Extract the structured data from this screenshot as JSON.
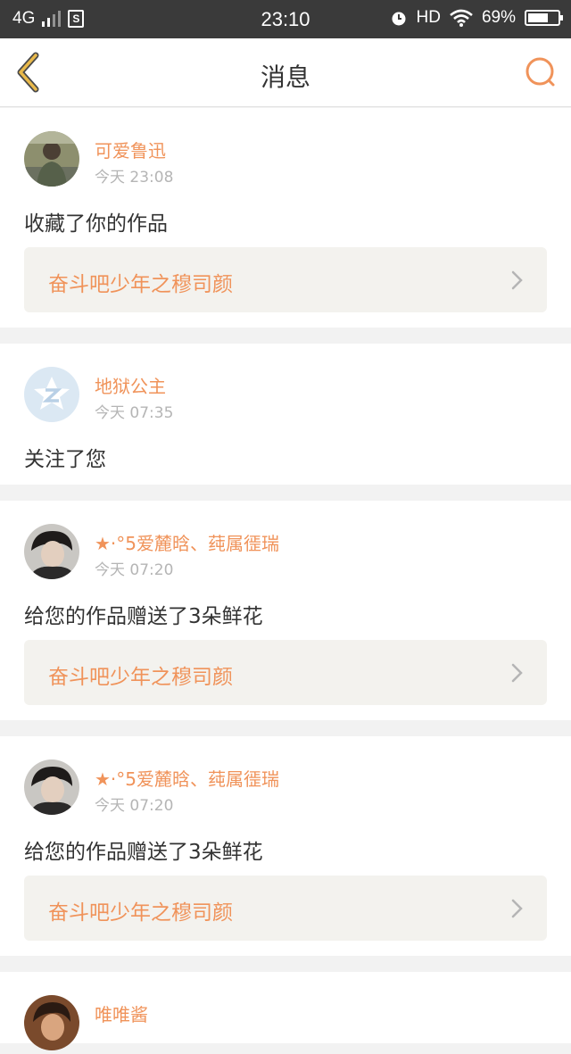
{
  "status_bar": {
    "network": "4G",
    "time": "23:10",
    "hd": "HD",
    "battery": "69%",
    "battery_level": 0.69
  },
  "nav": {
    "title": "消息"
  },
  "messages": [
    {
      "user": "可爱鲁迅",
      "time": "今天 23:08",
      "action": "收藏了你的作品",
      "work": "奋斗吧少年之穆司颜"
    },
    {
      "user": "地狱公主",
      "time": "今天 07:35",
      "action": "关注了您",
      "work": ""
    },
    {
      "user": "★·°5爱麓晗、莼属徰瑞",
      "time": "今天 07:20",
      "action": "给您的作品赠送了3朵鲜花",
      "work": "奋斗吧少年之穆司颜"
    },
    {
      "user": "★·°5爱麓晗、莼属徰瑞",
      "time": "今天 07:20",
      "action": "给您的作品赠送了3朵鲜花",
      "work": "奋斗吧少年之穆司颜"
    },
    {
      "user": "唯唯酱",
      "time": "",
      "action": "",
      "work": ""
    }
  ],
  "colors": {
    "accent": "#f0935a",
    "back_icon": "#e9b94a",
    "status_bar": "#3a3a3a"
  },
  "icons": {
    "back": "chevron-left-icon",
    "search": "search-icon",
    "link": "chevron-right-icon"
  }
}
